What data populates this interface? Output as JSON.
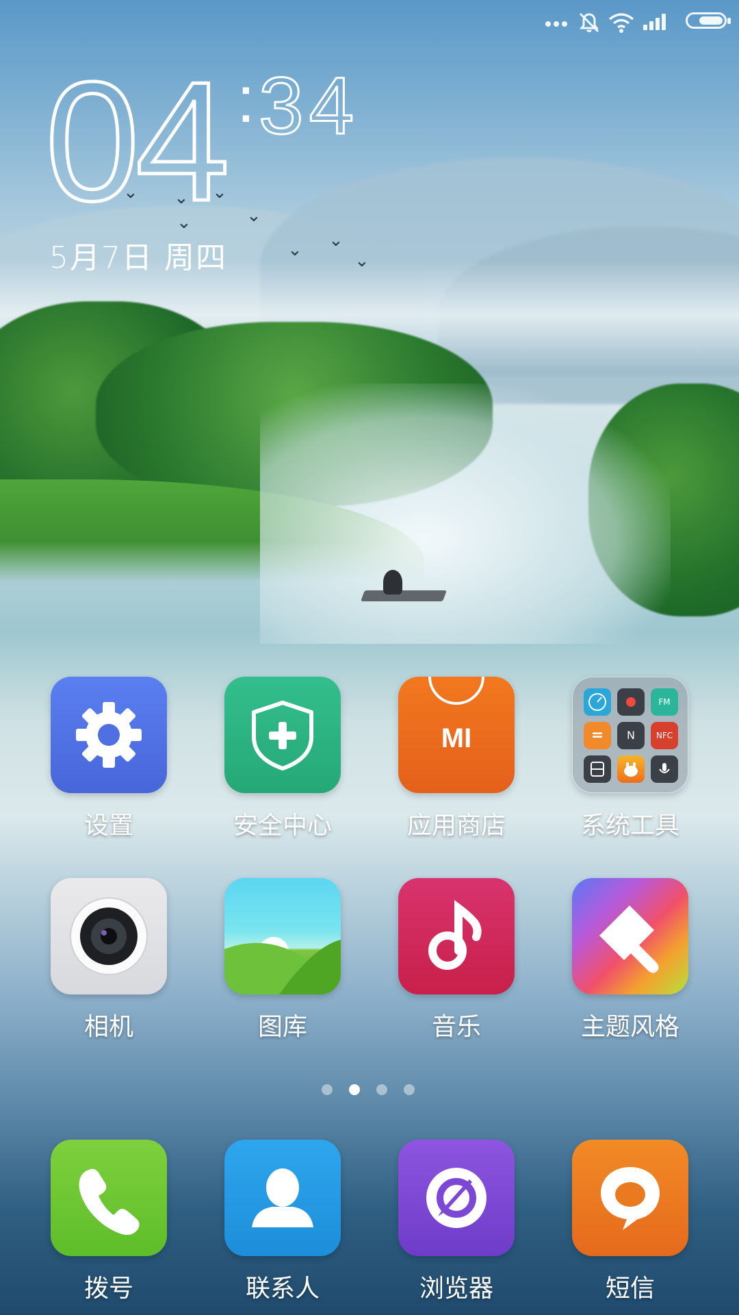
{
  "status_bar": {
    "more_icon": "more-dots-icon",
    "mute_icon": "mute-bell-icon",
    "wifi_icon": "wifi-icon",
    "signal_icon": "signal-icon",
    "battery_icon": "battery-icon"
  },
  "clock": {
    "hour": "04",
    "minute": "34",
    "colon": ":",
    "date": "5月7日 周四"
  },
  "apps": [
    {
      "label": "设置",
      "icon": "gear-icon"
    },
    {
      "label": "安全中心",
      "icon": "shield-plus-icon"
    },
    {
      "label": "应用商店",
      "icon": "mi-store-icon",
      "icon_text": "MI"
    },
    {
      "label": "系统工具",
      "icon": "folder-icon"
    },
    {
      "label": "相机",
      "icon": "camera-icon"
    },
    {
      "label": "图库",
      "icon": "gallery-icon"
    },
    {
      "label": "音乐",
      "icon": "music-note-icon"
    },
    {
      "label": "主题风格",
      "icon": "paint-brush-icon"
    }
  ],
  "folder_minis": {
    "fm": "FM",
    "n": "N",
    "nfc": "NFC",
    "eq": "="
  },
  "page_indicator": {
    "count": 4,
    "active_index": 1
  },
  "dock": [
    {
      "label": "拨号",
      "icon": "phone-icon"
    },
    {
      "label": "联系人",
      "icon": "contact-icon"
    },
    {
      "label": "浏览器",
      "icon": "browser-icon"
    },
    {
      "label": "短信",
      "icon": "message-bubble-icon"
    }
  ],
  "colors": {
    "settings": "#4f70e3",
    "security": "#2db383",
    "store": "#ea6a1d",
    "music": "#d02a5a",
    "phone": "#6fc633",
    "contacts": "#2599e3",
    "browser": "#7c47d4",
    "sms": "#ea7a20"
  }
}
